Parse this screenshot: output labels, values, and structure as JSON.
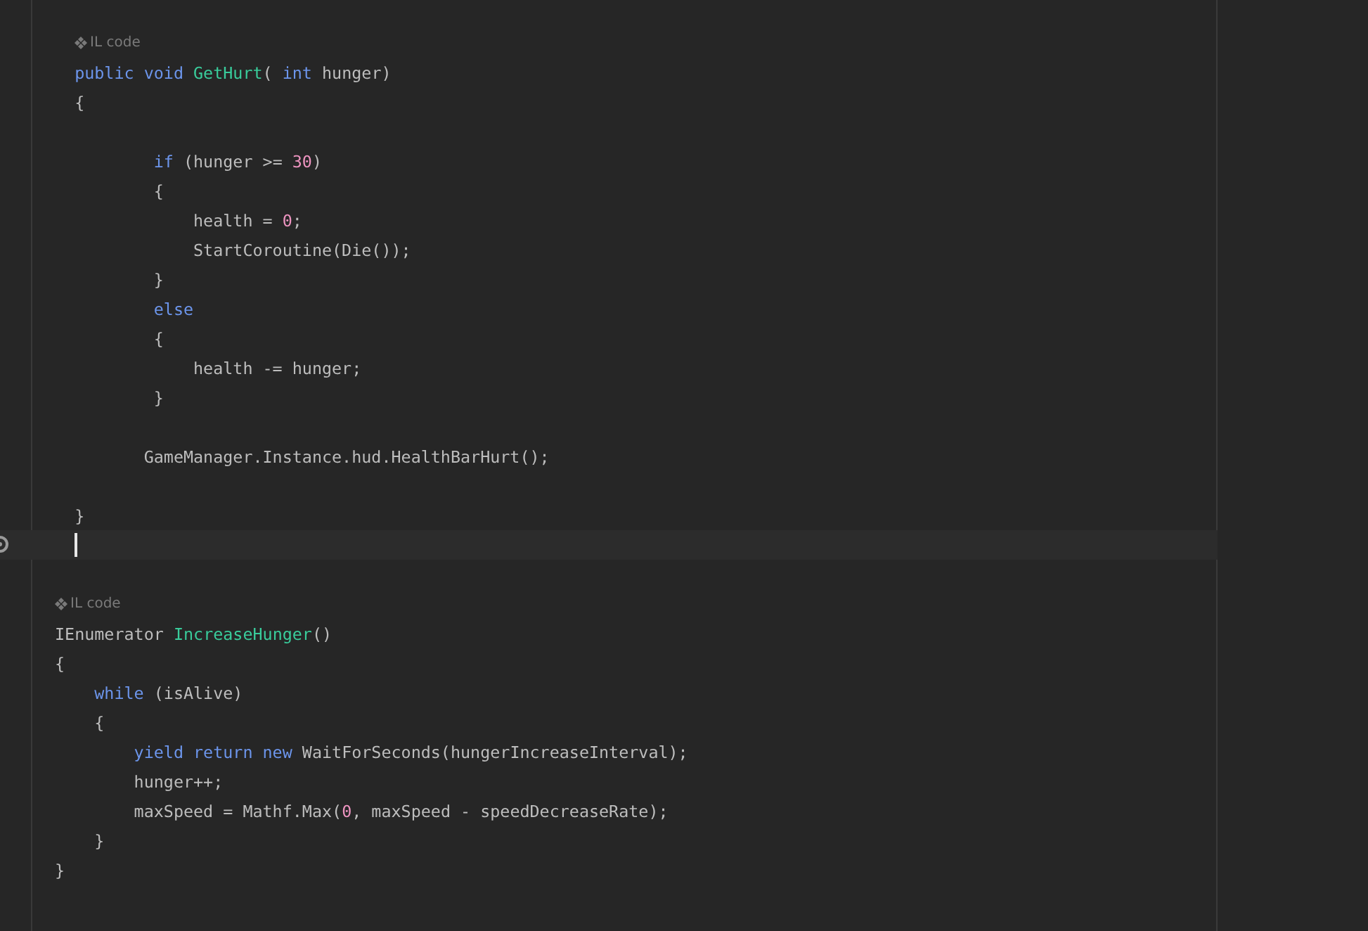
{
  "editor": {
    "lines": [
      {
        "kind": "hint",
        "text": "IL code"
      },
      {
        "kind": "code",
        "tokens": [
          {
            "text": "  public void ",
            "kind": "keyword"
          },
          {
            "text": "GetHurt",
            "kind": "method"
          },
          {
            "text": "( ",
            "kind": "plain"
          },
          {
            "text": "int ",
            "kind": "keyword"
          },
          {
            "text": "hunger)",
            "kind": "plain"
          }
        ]
      },
      {
        "kind": "code",
        "tokens": [
          {
            "text": "  {",
            "kind": "plain"
          }
        ]
      },
      {
        "kind": "blank"
      },
      {
        "kind": "code",
        "tokens": [
          {
            "text": "          if ",
            "kind": "keyword"
          },
          {
            "text": "(hunger >= ",
            "kind": "plain"
          },
          {
            "text": "30",
            "kind": "number"
          },
          {
            "text": ")",
            "kind": "plain"
          }
        ]
      },
      {
        "kind": "code",
        "tokens": [
          {
            "text": "          {",
            "kind": "plain"
          }
        ]
      },
      {
        "kind": "code",
        "tokens": [
          {
            "text": "              health = ",
            "kind": "plain"
          },
          {
            "text": "0",
            "kind": "number"
          },
          {
            "text": ";",
            "kind": "plain"
          }
        ]
      },
      {
        "kind": "code",
        "tokens": [
          {
            "text": "              StartCoroutine(Die());",
            "kind": "plain"
          }
        ]
      },
      {
        "kind": "code",
        "tokens": [
          {
            "text": "          }",
            "kind": "plain"
          }
        ]
      },
      {
        "kind": "code",
        "tokens": [
          {
            "text": "          else",
            "kind": "keyword"
          }
        ]
      },
      {
        "kind": "code",
        "tokens": [
          {
            "text": "          {",
            "kind": "plain"
          }
        ]
      },
      {
        "kind": "code",
        "tokens": [
          {
            "text": "              health -= hunger;",
            "kind": "plain"
          }
        ]
      },
      {
        "kind": "code",
        "tokens": [
          {
            "text": "          }",
            "kind": "plain"
          }
        ]
      },
      {
        "kind": "blank"
      },
      {
        "kind": "code",
        "tokens": [
          {
            "text": "         GameManager.Instance.hud.HealthBarHurt();",
            "kind": "plain"
          }
        ]
      },
      {
        "kind": "blank"
      },
      {
        "kind": "code",
        "tokens": [
          {
            "text": "  }",
            "kind": "plain"
          }
        ]
      },
      {
        "kind": "cursor"
      },
      {
        "kind": "blank"
      },
      {
        "kind": "hint",
        "text": "IL code"
      },
      {
        "kind": "code",
        "tokens": [
          {
            "text": "IEnumerator ",
            "kind": "plain"
          },
          {
            "text": "IncreaseHunger",
            "kind": "method"
          },
          {
            "text": "()",
            "kind": "plain"
          }
        ]
      },
      {
        "kind": "code",
        "tokens": [
          {
            "text": "{",
            "kind": "plain"
          }
        ]
      },
      {
        "kind": "code",
        "tokens": [
          {
            "text": "    while ",
            "kind": "keyword"
          },
          {
            "text": "(isAlive)",
            "kind": "plain"
          }
        ]
      },
      {
        "kind": "code",
        "tokens": [
          {
            "text": "    {",
            "kind": "plain"
          }
        ]
      },
      {
        "kind": "code",
        "tokens": [
          {
            "text": "        yield return new ",
            "kind": "keyword"
          },
          {
            "text": "WaitForSeconds(hungerIncreaseInterval);",
            "kind": "plain"
          }
        ]
      },
      {
        "kind": "code",
        "tokens": [
          {
            "text": "        hunger++;",
            "kind": "plain"
          }
        ]
      },
      {
        "kind": "code",
        "tokens": [
          {
            "text": "        maxSpeed = Mathf.Max(",
            "kind": "plain"
          },
          {
            "text": "0",
            "kind": "number"
          },
          {
            "text": ", maxSpeed - speedDecreaseRate);",
            "kind": "plain"
          }
        ]
      },
      {
        "kind": "code",
        "tokens": [
          {
            "text": "    }",
            "kind": "plain"
          }
        ]
      },
      {
        "kind": "code",
        "tokens": [
          {
            "text": "}",
            "kind": "plain"
          }
        ]
      }
    ]
  }
}
